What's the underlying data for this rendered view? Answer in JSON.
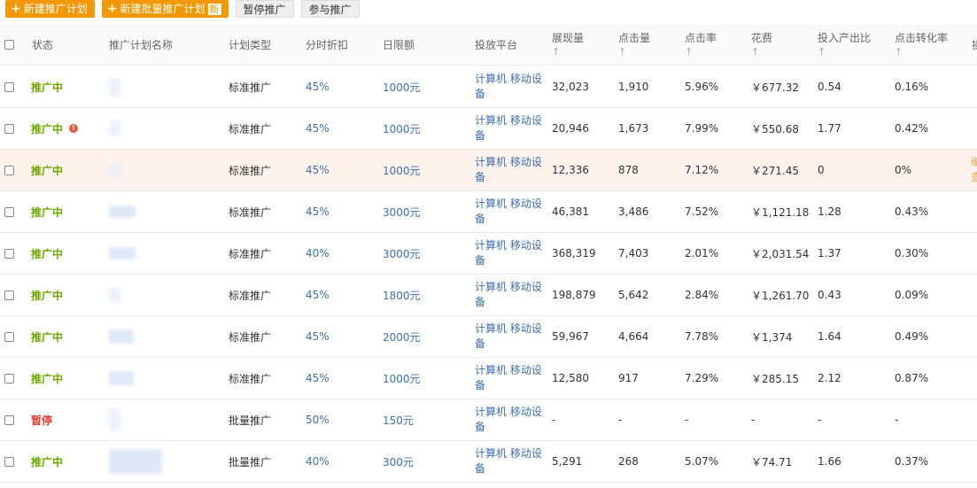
{
  "toolbar": {
    "new_plan": "新建推广计划",
    "new_batch_plan": "新建批量推广计划",
    "new_tag": "新",
    "pause": "暂停推广",
    "join": "参与推广",
    "plus_icon": "+"
  },
  "columns": {
    "status": "状态",
    "name": "推广计划名称",
    "type": "计划类型",
    "discount": "分时折扣",
    "daily_limit": "日限额",
    "platform": "投放平台",
    "impressions": "展现量",
    "clicks": "点击量",
    "ctr": "点击率",
    "cost": "花费",
    "roi": "投入产出比",
    "cvr": "点击转化率",
    "extra": "操",
    "sort_arrow": "↑"
  },
  "rows": [
    {
      "status": "推广中",
      "type": "标准推广",
      "discount": "45%",
      "limit": "1000元",
      "platform": "计算机 移动设备",
      "impressions": "32,023",
      "clicks": "1,910",
      "ctr": "5.96%",
      "cost": "￥677.32",
      "roi": "0.54",
      "cvr": "0.16%"
    },
    {
      "status": "推广中",
      "type": "标准推广",
      "discount": "45%",
      "limit": "1000元",
      "platform": "计算机 移动设备",
      "impressions": "20,946",
      "clicks": "1,673",
      "ctr": "7.99%",
      "cost": "￥550.68",
      "roi": "1.77",
      "cvr": "0.42%"
    },
    {
      "status": "推广中",
      "type": "标准推广",
      "discount": "45%",
      "limit": "1000元",
      "platform": "计算机 移动设备",
      "impressions": "12,336",
      "clicks": "878",
      "ctr": "7.12%",
      "cost": "￥271.45",
      "roi": "0",
      "cvr": "0%"
    },
    {
      "status": "推广中",
      "type": "标准推广",
      "discount": "45%",
      "limit": "3000元",
      "platform": "计算机 移动设备",
      "impressions": "46,381",
      "clicks": "3,486",
      "ctr": "7.52%",
      "cost": "￥1,121.18",
      "roi": "1.28",
      "cvr": "0.43%"
    },
    {
      "status": "推广中",
      "type": "标准推广",
      "discount": "40%",
      "limit": "3000元",
      "platform": "计算机 移动设备",
      "impressions": "368,319",
      "clicks": "7,403",
      "ctr": "2.01%",
      "cost": "￥2,031.54",
      "roi": "1.37",
      "cvr": "0.30%"
    },
    {
      "status": "推广中",
      "type": "标准推广",
      "discount": "45%",
      "limit": "1800元",
      "platform": "计算机 移动设备",
      "impressions": "198,879",
      "clicks": "5,642",
      "ctr": "2.84%",
      "cost": "￥1,261.70",
      "roi": "0.43",
      "cvr": "0.09%"
    },
    {
      "status": "推广中",
      "type": "标准推广",
      "discount": "45%",
      "limit": "2000元",
      "platform": "计算机 移动设备",
      "impressions": "59,967",
      "clicks": "4,664",
      "ctr": "7.78%",
      "cost": "￥1,374",
      "roi": "1.64",
      "cvr": "0.49%"
    },
    {
      "status": "推广中",
      "type": "标准推广",
      "discount": "45%",
      "limit": "1000元",
      "platform": "计算机 移动设备",
      "impressions": "12,580",
      "clicks": "917",
      "ctr": "7.29%",
      "cost": "￥285.15",
      "roi": "2.12",
      "cvr": "0.87%"
    },
    {
      "status": "暂停",
      "type": "批量推广",
      "discount": "50%",
      "limit": "150元",
      "platform": "计算机 移动设备",
      "impressions": "-",
      "clicks": "-",
      "ctr": "-",
      "cost": "-",
      "roi": "-",
      "cvr": "-"
    },
    {
      "status": "推广中",
      "type": "批量推广",
      "discount": "40%",
      "limit": "300元",
      "platform": "计算机 移动设备",
      "impressions": "5,291",
      "clicks": "268",
      "ctr": "5.07%",
      "cost": "￥74.71",
      "roi": "1.66",
      "cvr": "0.37%"
    }
  ],
  "row3_edge_text": "编 查",
  "colors": {
    "accent": "#f39800",
    "active": "#6aa800",
    "paused": "#e23b2d",
    "link": "#3d6fb6",
    "highlight_row": "#fdf3ec"
  }
}
